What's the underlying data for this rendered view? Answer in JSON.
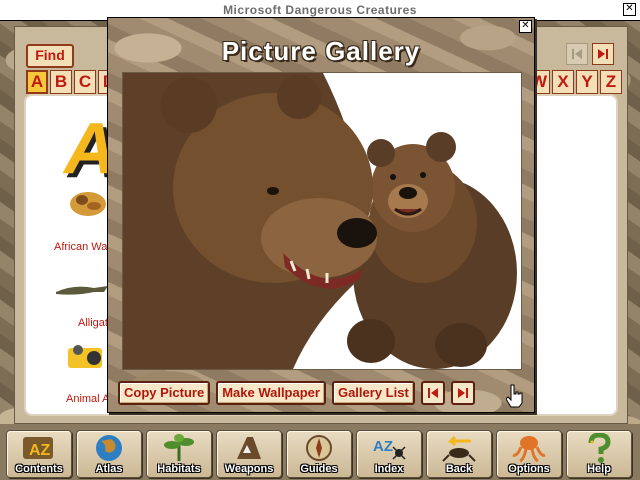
{
  "window": {
    "title": "Microsoft Dangerous Creatures",
    "close_glyph": "✕"
  },
  "back_page": {
    "find_label": "Find",
    "letters_left": [
      "A",
      "B",
      "C",
      "D"
    ],
    "letters_right": [
      "W",
      "X",
      "Y",
      "Z"
    ],
    "active_letter": "A",
    "big_letter": "A",
    "entries": [
      "African Wa",
      "Alligat",
      "Animal A"
    ]
  },
  "gallery": {
    "heading": "Picture Gallery",
    "close_glyph": "✕",
    "buttons": {
      "copy": "Copy Picture",
      "wallpaper": "Make Wallpaper",
      "list": "Gallery List"
    }
  },
  "toolbar": {
    "items": [
      {
        "label": "Contents",
        "icon": "contents-az-icon"
      },
      {
        "label": "Atlas",
        "icon": "globe-icon"
      },
      {
        "label": "Habitats",
        "icon": "plant-icon"
      },
      {
        "label": "Weapons",
        "icon": "weapons-icon"
      },
      {
        "label": "Guides",
        "icon": "compass-icon"
      },
      {
        "label": "Index",
        "icon": "az-spider-icon"
      },
      {
        "label": "Back",
        "icon": "scorpion-back-icon"
      },
      {
        "label": "Options",
        "icon": "octopus-icon"
      },
      {
        "label": "Help",
        "icon": "snake-question-icon"
      }
    ]
  },
  "colors": {
    "accent_red": "#c0190f",
    "button_face": "#f5e7c8",
    "letter_gold": "#f6b71c"
  }
}
